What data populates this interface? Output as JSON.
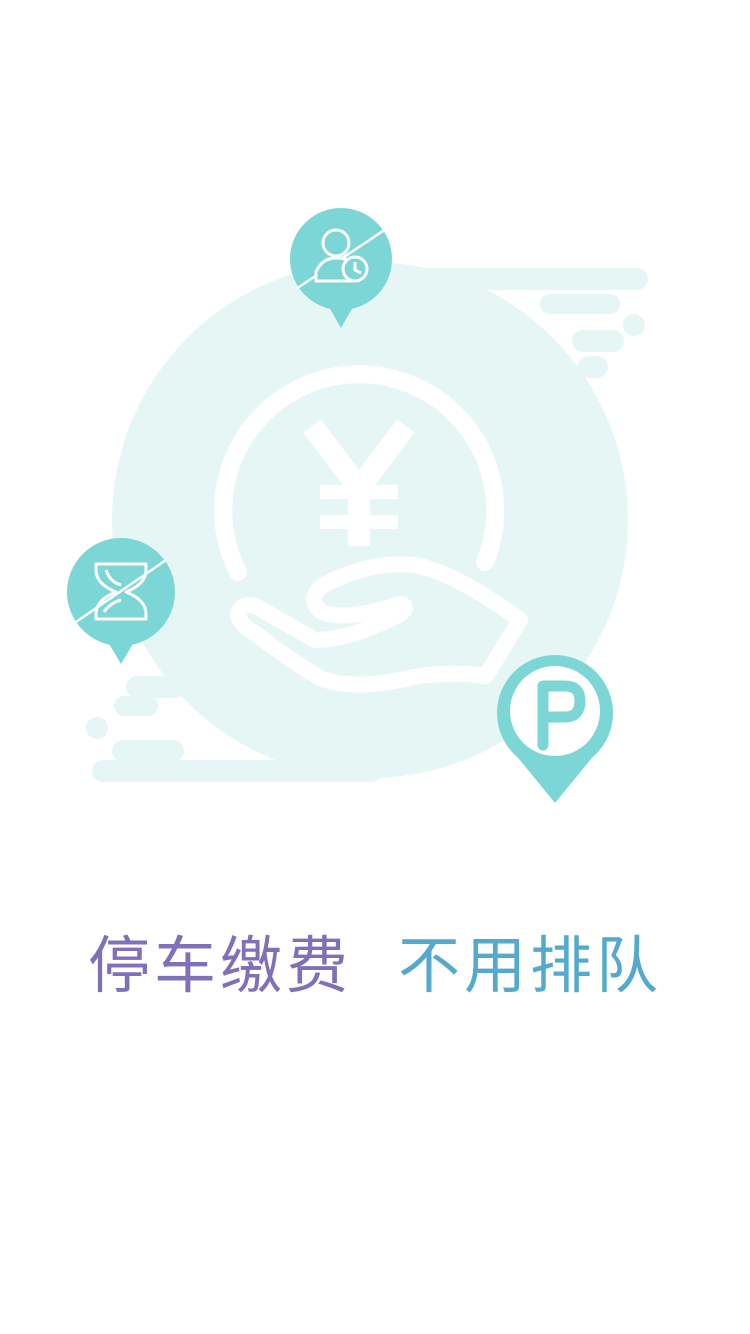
{
  "illustration": {
    "main_icon": "yen-coin-in-hand-icon",
    "pins": [
      {
        "name": "user-clock-pin",
        "icon": "user-clock-icon"
      },
      {
        "name": "hourglass-pin",
        "icon": "hourglass-icon"
      },
      {
        "name": "parking-pin",
        "icon": "parking-icon",
        "label": "P"
      }
    ],
    "colors": {
      "blob": "#e5f6f5",
      "pin": "#7dd6d6",
      "line_white": "#ffffff"
    }
  },
  "tagline": {
    "part1": "停车缴费",
    "part2": "不用排队",
    "colors": {
      "part1": "#8070b8",
      "part2": "#54a9cc"
    }
  }
}
